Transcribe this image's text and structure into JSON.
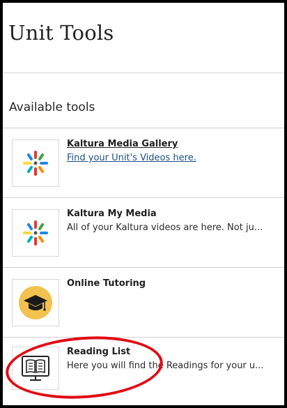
{
  "page": {
    "title": "Unit Tools"
  },
  "section": {
    "title": "Available tools"
  },
  "tools": [
    {
      "name": "Kaltura Media Gallery",
      "description": "Find your Unit's Videos here.",
      "icon": "kaltura-logo-icon"
    },
    {
      "name": "Kaltura My Media",
      "description": "All of your Kaltura videos are here. Not ju...",
      "icon": "kaltura-logo-icon"
    },
    {
      "name": "Online Tutoring",
      "description": "",
      "icon": "graduation-cap-icon"
    },
    {
      "name": "Reading List",
      "description": "Here you will find the Readings for your u...",
      "icon": "open-book-screen-icon"
    }
  ],
  "colors": {
    "link": "#1d4f86",
    "annotation": "#e10b13",
    "tutoring_badge": "#f2c14e"
  }
}
